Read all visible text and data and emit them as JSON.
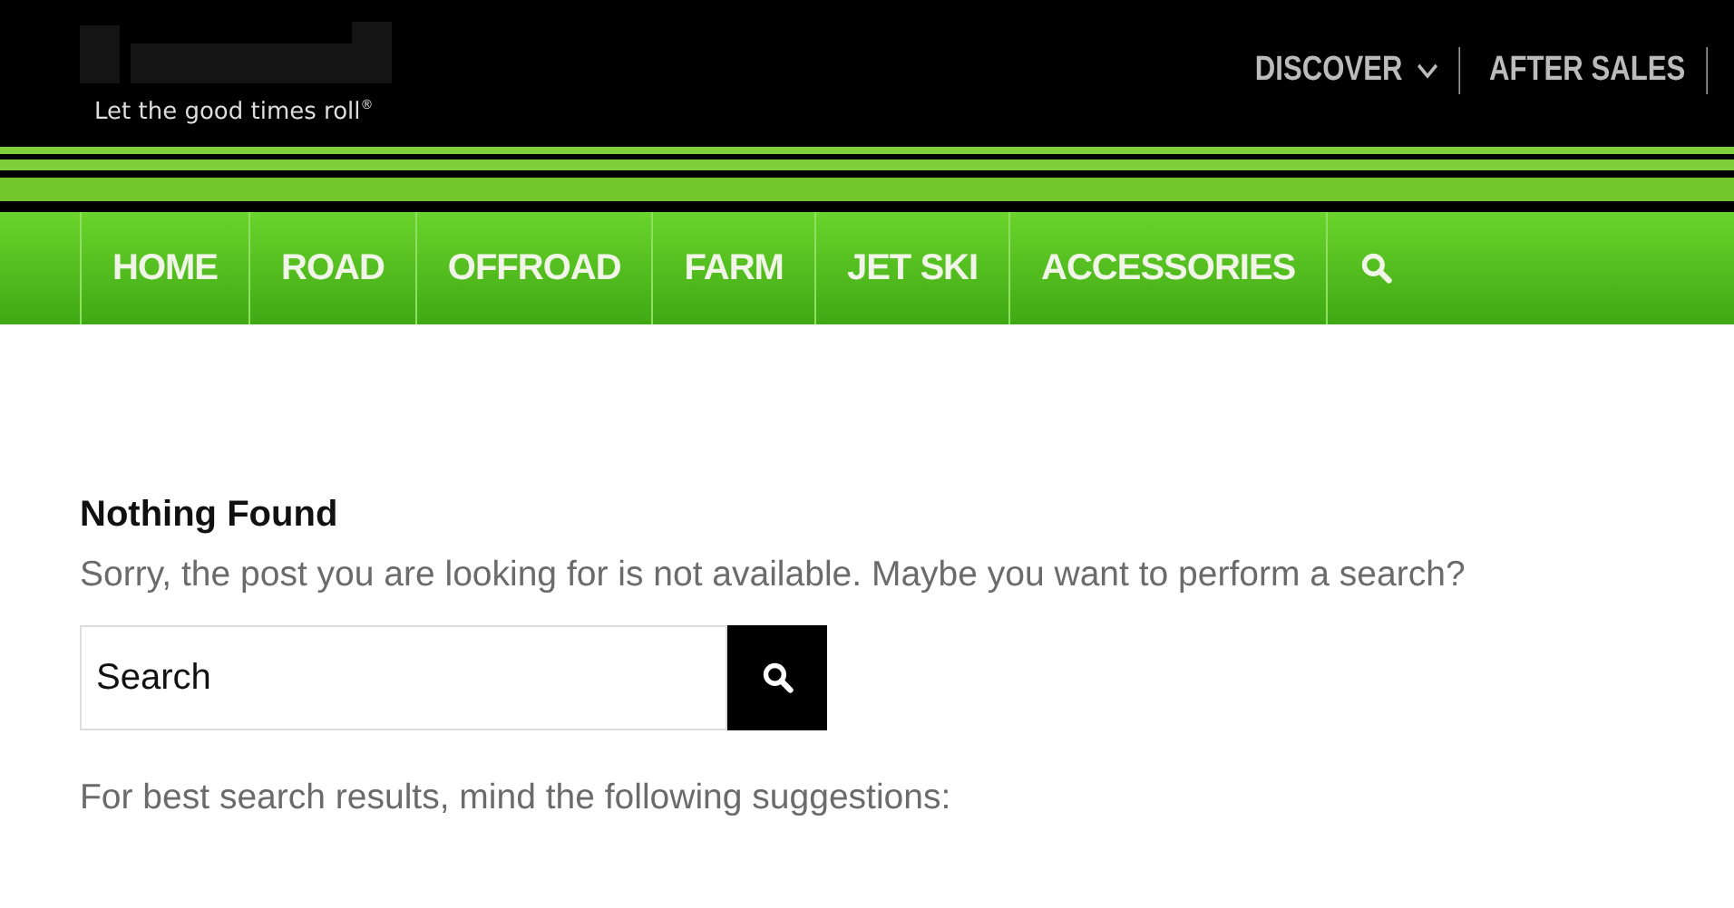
{
  "header": {
    "tagline": "Let the good times roll",
    "tagline_mark": "®",
    "top_links": [
      {
        "label": "DISCOVER",
        "has_dropdown": true
      },
      {
        "label": "AFTER SALES",
        "has_dropdown": false
      }
    ]
  },
  "nav": {
    "items": [
      {
        "label": "HOME"
      },
      {
        "label": "ROAD"
      },
      {
        "label": "OFFROAD"
      },
      {
        "label": "FARM"
      },
      {
        "label": "JET SKI"
      },
      {
        "label": "ACCESSORIES"
      }
    ]
  },
  "content": {
    "title": "Nothing Found",
    "message": "Sorry, the post you are looking for is not available. Maybe you want to perform a search?",
    "search": {
      "value": "Search"
    },
    "suggestions_intro": "For best search results, mind the following suggestions:"
  }
}
